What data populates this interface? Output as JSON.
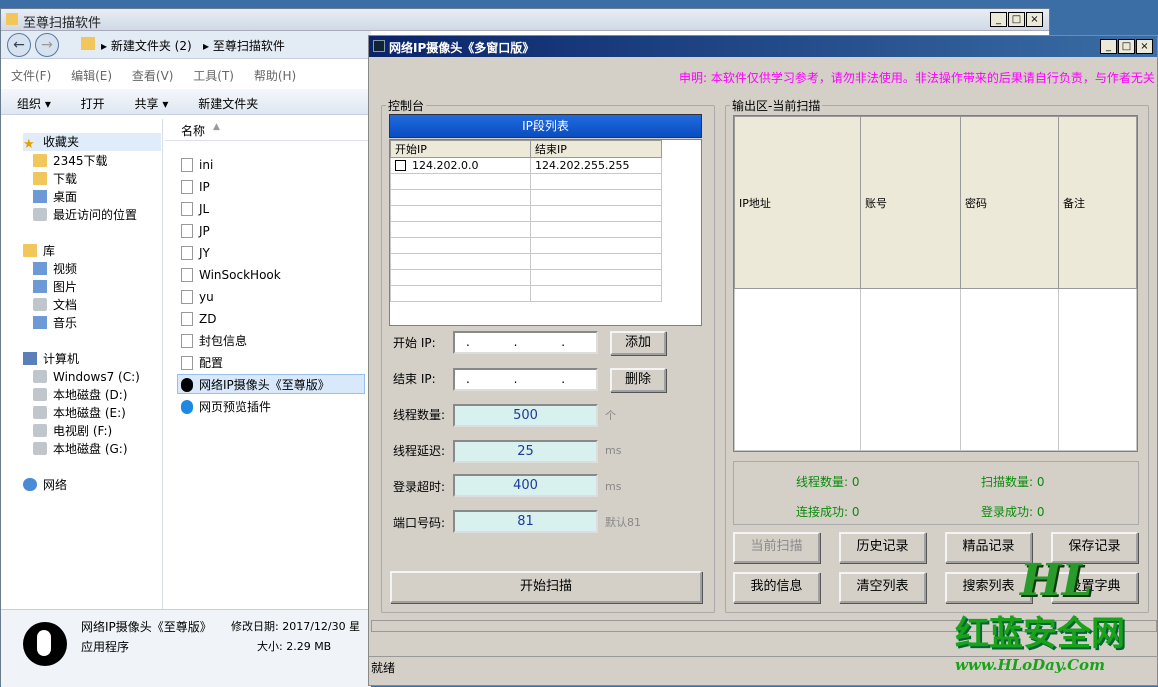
{
  "explorer": {
    "title": "至尊扫描软件",
    "breadcrumb": [
      "新建文件夹 (2)",
      "至尊扫描软件"
    ],
    "menu": [
      "文件(F)",
      "编辑(E)",
      "查看(V)",
      "工具(T)",
      "帮助(H)"
    ],
    "toolbar": [
      "组织 ▾",
      "打开",
      "共享 ▾",
      "新建文件夹"
    ],
    "nav": {
      "favorites": "收藏夹",
      "favorites_items": [
        "2345下载",
        "下载",
        "桌面",
        "最近访问的位置"
      ],
      "library": "库",
      "library_items": [
        "视频",
        "图片",
        "文档",
        "音乐"
      ],
      "computer": "计算机",
      "computer_items": [
        "Windows7 (C:)",
        "本地磁盘 (D:)",
        "本地磁盘 (E:)",
        "电视剧 (F:)",
        "本地磁盘 (G:)"
      ],
      "network": "网络"
    },
    "column_name": "名称",
    "files": [
      "ini",
      "IP",
      "JL",
      "JP",
      "JY",
      "WinSockHook",
      "yu",
      "ZD",
      "封包信息",
      "配置",
      "网络IP摄像头《至尊版》",
      "网页预览插件"
    ],
    "detail": {
      "name": "网络IP摄像头《至尊版》",
      "modified": "修改日期: 2017/12/30 星",
      "type": "应用程序",
      "size": "大小: 2.29 MB"
    }
  },
  "app": {
    "title": "网络IP摄像头《多窗口版》",
    "disclaimer": "申明: 本软件仅供学习参考，请勿非法使用。非法操作带来的后果请自行负责，与作者无关",
    "control_legend": "控制台",
    "ip_list_header": "IP段列表",
    "ip_columns": [
      "开始IP",
      "结束IP"
    ],
    "ip_rows": [
      {
        "start": "124.202.0.0",
        "end": "124.202.255.255"
      }
    ],
    "start_label": "开始 IP:",
    "end_label": "结束 IP:",
    "ip_placeholder": ". . .",
    "add_button": "添加",
    "delete_button": "删除",
    "threads_label": "线程数量:",
    "threads_value": "500",
    "threads_unit": "个",
    "delay_label": "线程延迟:",
    "delay_value": "25",
    "delay_unit": "ms",
    "timeout_label": "登录超时:",
    "timeout_value": "400",
    "timeout_unit": "ms",
    "port_label": "端口号码:",
    "port_value": "81",
    "port_default": "默认81",
    "start_scan_button": "开始扫描",
    "output_legend": "输出区-当前扫描",
    "output_columns": [
      "IP地址",
      "账号",
      "密码",
      "备注"
    ],
    "stats": {
      "threads": "线程数量: 0",
      "scanned": "扫描数量: 0",
      "connected": "连接成功: 0",
      "logged": "登录成功: 0"
    },
    "buttons": [
      "当前扫描",
      "历史记录",
      "精品记录",
      "保存记录",
      "我的信息",
      "清空列表",
      "搜索列表",
      "设置字典"
    ],
    "status": "就绪"
  },
  "watermark": {
    "logo": "HL",
    "name": "红蓝安全网",
    "url": "www.HLoDay.Com"
  }
}
